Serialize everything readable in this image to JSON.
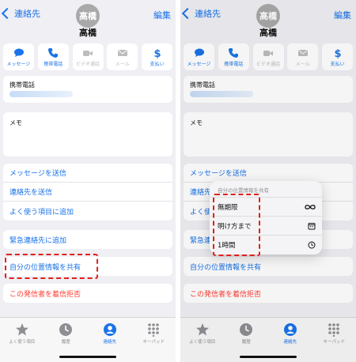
{
  "nav": {
    "back_label": "連絡先",
    "edit_label": "編集"
  },
  "contact": {
    "avatar_text": "高橋",
    "name": "高橋"
  },
  "actions": [
    {
      "label": "メッセージ",
      "icon": "message-icon",
      "enabled": true
    },
    {
      "label": "携帯電話",
      "icon": "phone-icon",
      "enabled": true
    },
    {
      "label": "ビデオ通話",
      "icon": "video-icon",
      "enabled": false
    },
    {
      "label": "メール",
      "icon": "mail-icon",
      "enabled": false
    },
    {
      "label": "支払い",
      "icon": "dollar-icon",
      "enabled": true
    }
  ],
  "phone_card": {
    "label": "携帯電話"
  },
  "memo_card": {
    "label": "メモ"
  },
  "list_items": {
    "send_message": "メッセージを送信",
    "send_contact": "連絡先を送信",
    "add_favorite": "よく使う項目に追加",
    "add_emergency": "緊急連絡先に追加",
    "share_location": "自分の位置情報を共有",
    "block_caller": "この発信者を着信拒否"
  },
  "tabs": [
    {
      "label": "よく使う項目",
      "icon": "star-icon"
    },
    {
      "label": "履歴",
      "icon": "clock-icon"
    },
    {
      "label": "連絡先",
      "icon": "person-icon"
    },
    {
      "label": "キーパッド",
      "icon": "keypad-icon"
    }
  ],
  "share_menu": {
    "header": "自分の位置情報を共有",
    "options": [
      {
        "label": "無期限",
        "icon": "infinity-icon"
      },
      {
        "label": "明け方まで",
        "icon": "calendar-icon"
      },
      {
        "label": "1時間",
        "icon": "clock-icon"
      }
    ]
  },
  "colors": {
    "accent": "#1a73e8",
    "destructive": "#ff3b30",
    "highlight": "#e0201b"
  }
}
